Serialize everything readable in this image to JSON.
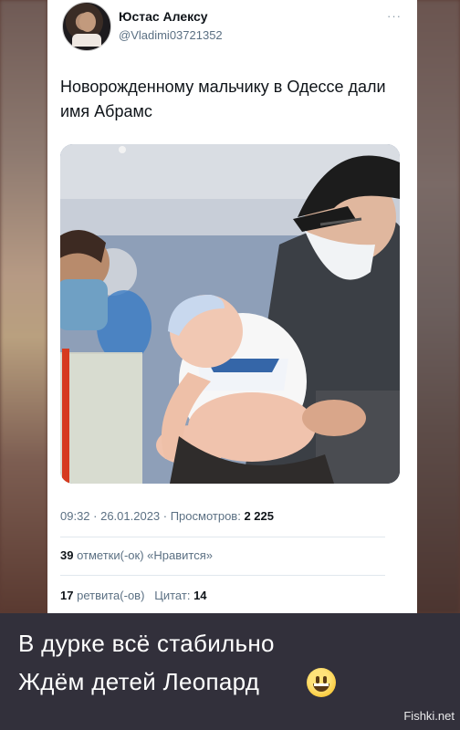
{
  "tweet": {
    "author_name": "Юстас Алексу",
    "author_handle": "@Vladimi03721352",
    "more_icon": "more-dots-icon",
    "text": "Новорожденному мальчику в Одессе дали имя Абрамс",
    "timestamp": "09:32 · 26.01.2023 · Просмотров:",
    "views": "2 225",
    "likes_count": "39",
    "likes_label": "отметки(-ок) «Нравится»",
    "retweets_count": "17",
    "retweets_label": "ретвита(-ов)",
    "quotes_label": "Цитат:",
    "quotes_count": "14"
  },
  "caption": {
    "line1": "В дурке всё стабильно",
    "line2": "Ждём детей Леопард",
    "emoji": "grinning-face-emoji"
  },
  "watermark": "Fishki.net"
}
